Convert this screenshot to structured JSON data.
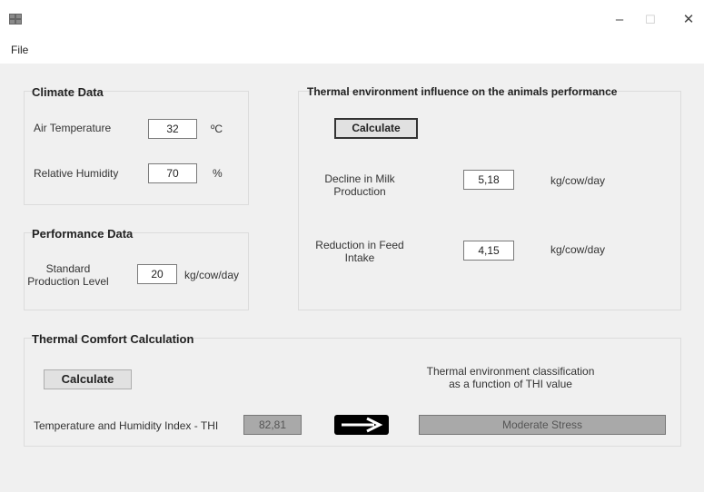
{
  "window": {
    "minimize_glyph": "–",
    "maximize_glyph": "☐",
    "close_glyph": "✕"
  },
  "menu": {
    "file": "File"
  },
  "climate": {
    "title": "Climate Data",
    "air_temp_label": "Air Temperature",
    "air_temp_value": "32",
    "air_temp_unit": "ºC",
    "humidity_label": "Relative Humidity",
    "humidity_value": "70",
    "humidity_unit": "%"
  },
  "performance": {
    "title": "Performance Data",
    "std_prod_label": "Standard Production Level",
    "std_prod_value": "20",
    "std_prod_unit": "kg/cow/day"
  },
  "thermal_influence": {
    "title": "Thermal environment influence on the animals performance",
    "calculate_label": "Calculate",
    "milk_decline_label": "Decline in Milk Production",
    "milk_decline_value": "5,18",
    "milk_decline_unit": "kg/cow/day",
    "feed_reduction_label": "Reduction in Feed Intake",
    "feed_reduction_value": "4,15",
    "feed_reduction_unit": "kg/cow/day"
  },
  "thermal_comfort": {
    "title": "Thermal Comfort Calculation",
    "calculate_label": "Calculate",
    "classification_caption": "Thermal environment classification as a function of THI value",
    "thi_label": "Temperature and Humidity Index - THI",
    "thi_value": "82,81",
    "classification_value": "Moderate Stress",
    "arrow_icon": "right-arrow-icon"
  }
}
